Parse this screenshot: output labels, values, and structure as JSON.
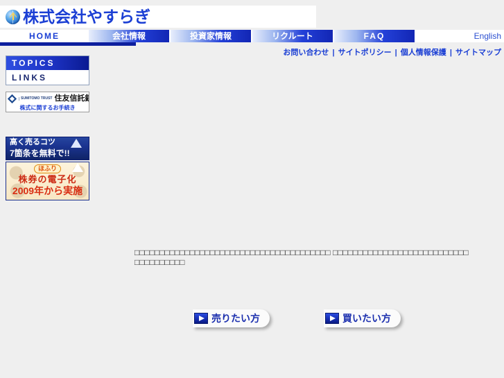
{
  "site": {
    "logo_text": "株式会社やすらぎ",
    "logo_icon": "globe-icon"
  },
  "nav": {
    "items": [
      {
        "label": "HOME",
        "active": true
      },
      {
        "label": "会社情報",
        "active": false
      },
      {
        "label": "投資家情報",
        "active": false
      },
      {
        "label": "リクルート",
        "active": false
      },
      {
        "label": "FAQ",
        "active": false
      }
    ],
    "english_label": "English"
  },
  "utilnav": {
    "separator": "|",
    "items": [
      {
        "label": "お問い合わせ"
      },
      {
        "label": "サイトポリシー"
      },
      {
        "label": "個人情報保護"
      },
      {
        "label": "サイトマップ"
      }
    ]
  },
  "sidebar": {
    "menu": [
      {
        "label": "TOPICS"
      },
      {
        "label": "LINKS"
      }
    ],
    "bank_banner": {
      "mark_label": "SUMITOMO TRUST",
      "name": "住友信託銀行",
      "sub": "株式に関するお手続き"
    },
    "ad_blue": {
      "line1": "高く売るコツ",
      "line2": "7箇条を無料で!!"
    },
    "ad_cream": {
      "pill": "ほふり",
      "line1": "株券の電子化",
      "line2": "2009年から実施"
    }
  },
  "main": {
    "body_text": "□□□□□□□□□□□□□□□□□□□□□□□□□□□□□□□□□□□□□□□ □□□□□□□□□□□□□□□□□□□□□□□□□□□□□□□□□□□□□",
    "cta": [
      {
        "label": "売りたい方",
        "icon": "play-arrow-icon"
      },
      {
        "label": "買いたい方",
        "icon": "play-arrow-icon"
      }
    ]
  },
  "colors": {
    "page_bg": "#efefef",
    "brand_blue": "#1b3fd4",
    "nav_deep_blue": "#0d1f9e",
    "accent_red": "#d92e12"
  }
}
